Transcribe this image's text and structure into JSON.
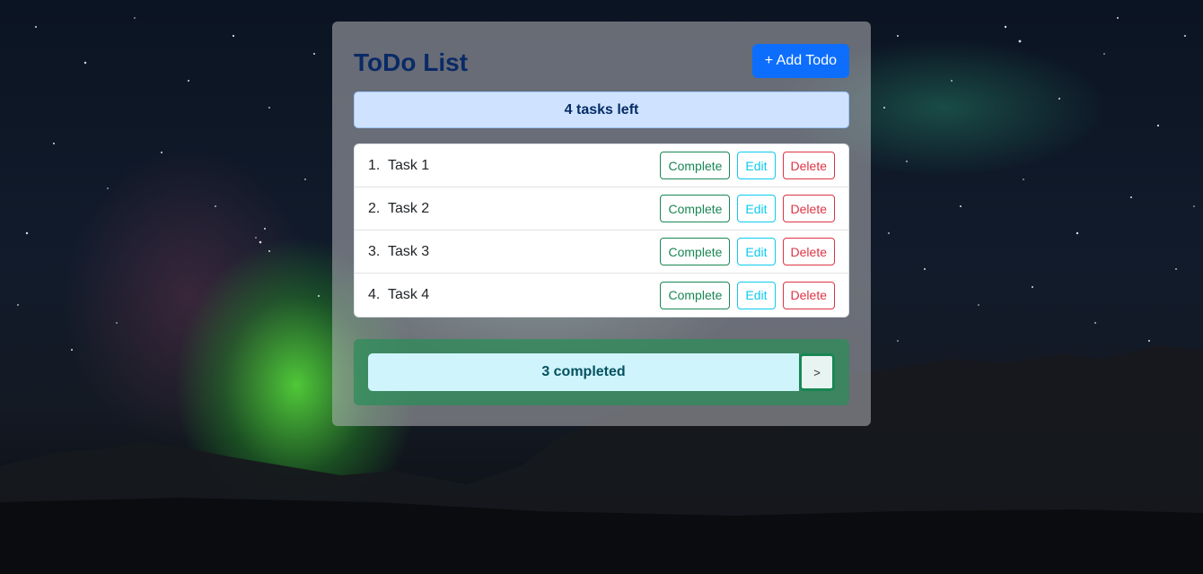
{
  "app": {
    "title": "ToDo List",
    "add_button_label": "+ Add Todo",
    "tasks_left_text": "4 tasks left"
  },
  "todos": [
    {
      "index": "1.",
      "label": "Task 1"
    },
    {
      "index": "2.",
      "label": "Task 2"
    },
    {
      "index": "3.",
      "label": "Task 3"
    },
    {
      "index": "4.",
      "label": "Task 4"
    }
  ],
  "item_actions": {
    "complete_label": "Complete",
    "edit_label": "Edit",
    "delete_label": "Delete"
  },
  "completed": {
    "text": "3 completed",
    "expand_label": ">"
  },
  "colors": {
    "primary": "#0d6efd",
    "success": "#198754",
    "info": "#0dcaf0",
    "danger": "#dc3545",
    "title": "#0a2a66"
  }
}
